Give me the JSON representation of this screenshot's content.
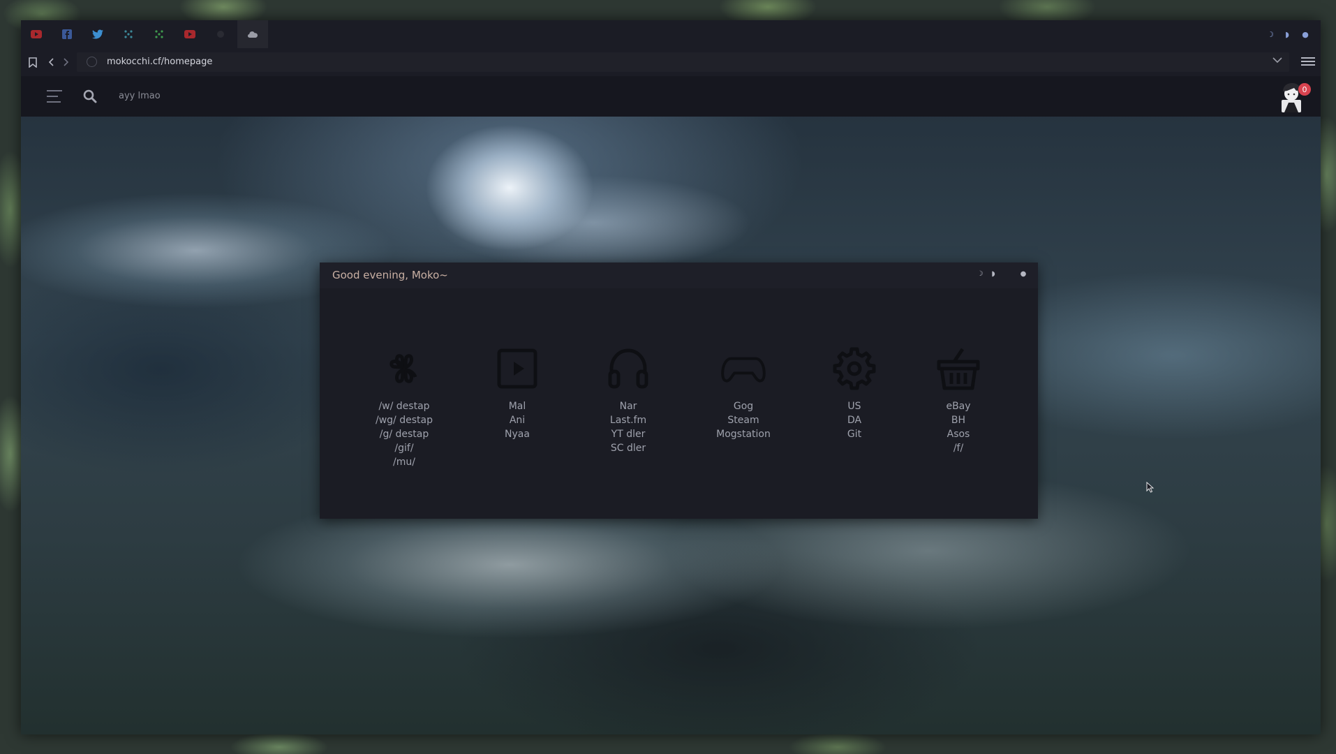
{
  "browser": {
    "url": "mokocchi.cf/homepage"
  },
  "page": {
    "search": {
      "value": "ayy lmao"
    },
    "avatar": {
      "notification_count": "0"
    },
    "card": {
      "title": "Good evening, Moko~",
      "columns": [
        {
          "icon": "clover-icon",
          "links": [
            "/w/ destap",
            "/wg/ destap",
            "/g/ destap",
            "/gif/",
            "/mu/"
          ]
        },
        {
          "icon": "play-icon",
          "links": [
            "Mal",
            "Ani",
            "Nyaa"
          ]
        },
        {
          "icon": "headphones-icon",
          "links": [
            "Nar",
            "Last.fm",
            "YT dler",
            "SC dler"
          ]
        },
        {
          "icon": "gamepad-icon",
          "links": [
            "Gog",
            "Steam",
            "Mogstation"
          ]
        },
        {
          "icon": "gear-icon",
          "links": [
            "US",
            "DA",
            "Git"
          ]
        },
        {
          "icon": "basket-icon",
          "links": [
            "eBay",
            "BH",
            "Asos",
            "/f/"
          ]
        }
      ]
    }
  }
}
